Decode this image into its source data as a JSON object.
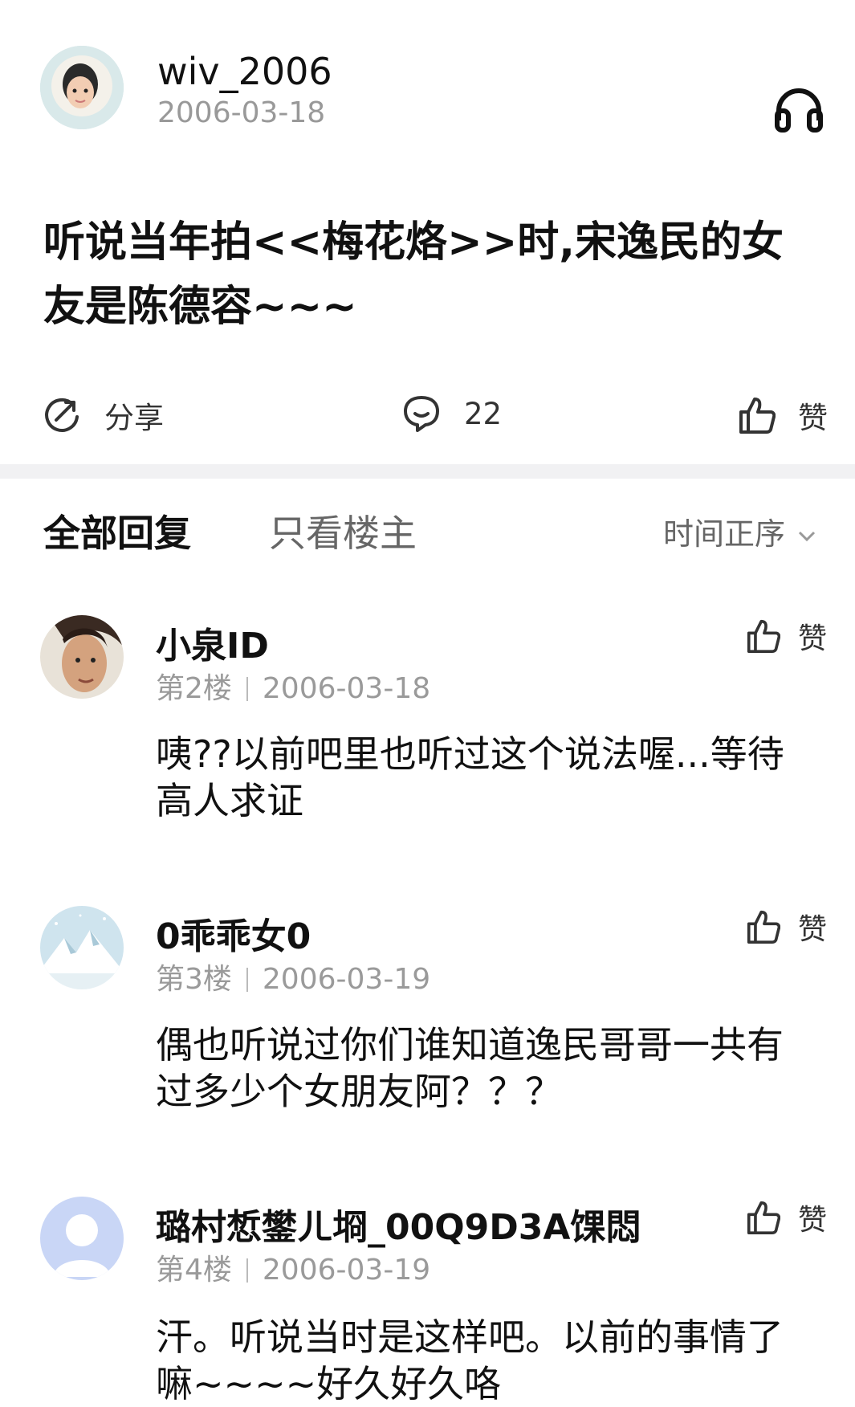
{
  "post": {
    "username": "wiv_2006",
    "date": "2006-03-18",
    "title": "听说当年拍<<梅花烙>>时,宋逸民的女友是陈德容~~~",
    "share_label": "分享",
    "comment_count": "22",
    "like_label": "赞"
  },
  "tabs": {
    "all_replies": "全部回复",
    "only_host": "只看楼主",
    "sort_label": "时间正序"
  },
  "replies": [
    {
      "name": "小泉ID",
      "floor": "第2楼",
      "date": "2006-03-18",
      "text": "咦??以前吧里也听过这个说法喔...等待高人求证",
      "like_label": "赞"
    },
    {
      "name": "0乖乖女0",
      "floor": "第3楼",
      "date": "2006-03-19",
      "text": "偶也听说过你们谁知道逸民哥哥一共有过多少个女朋友阿？？？",
      "like_label": "赞"
    },
    {
      "name": "璐村惁鐢ㄦ埛_00Q9D3A馃悶",
      "floor": "第4楼",
      "date": "2006-03-19",
      "text": "汗。听说当时是这样吧。以前的事情了嘛~~~~好久好久咯",
      "like_label": "赞"
    }
  ],
  "colors": {
    "separator": "#f1f1f3",
    "meta_gray": "#9a9a9a",
    "text": "#111111"
  }
}
